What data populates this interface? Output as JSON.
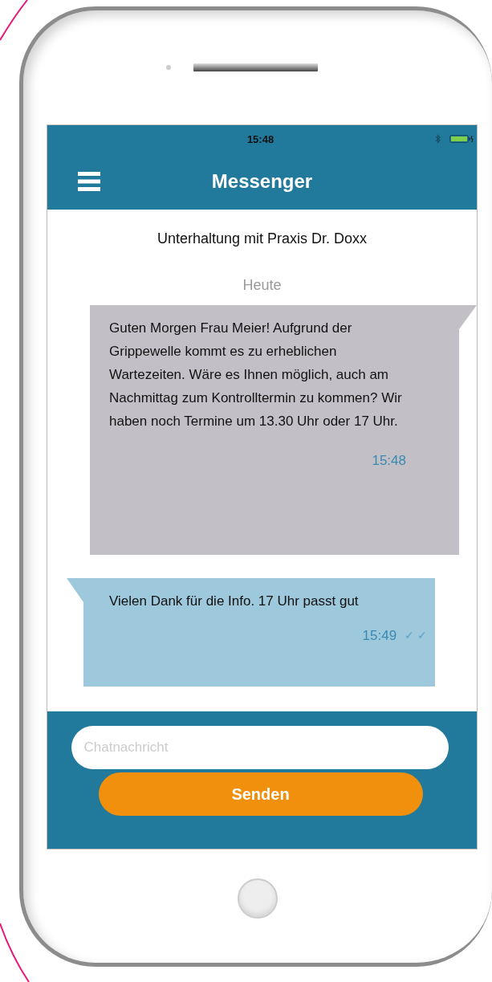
{
  "status_bar": {
    "time": "15:48"
  },
  "nav_bar": {
    "title": "Messenger"
  },
  "conversation_title": "Unterhaltung mit Praxis Dr. Doxx",
  "date_label": "Heute",
  "messages": [
    {
      "kind": "incoming",
      "text": "Guten Morgen Frau Meier! Aufgrund der Grippewelle kommt es zu erheblichen Wartezeiten. Wäre es Ihnen möglich, auch am Nachmittag zum Kontrolltermin zu kommen? Wir haben noch Termine um 13.30 Uhr oder 17 Uhr.",
      "time": "15:48"
    },
    {
      "kind": "outgoing",
      "text": "Vielen Dank für die Info. 17 Uhr passt gut",
      "time": "15:49",
      "ticks": "✓ ✓"
    }
  ],
  "composer": {
    "placeholder": "Chatnachricht",
    "send_button": "Senden"
  }
}
